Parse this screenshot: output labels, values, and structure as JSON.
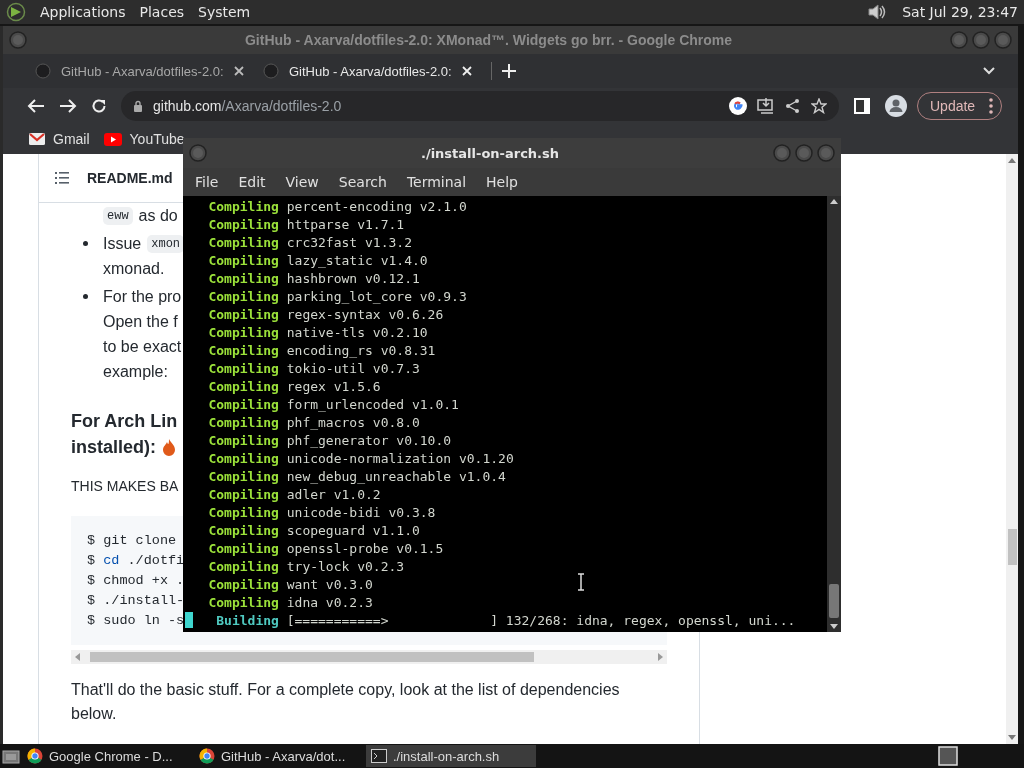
{
  "top_panel": {
    "menus": [
      "Applications",
      "Places",
      "System"
    ],
    "clock": "Sat Jul 29, 23:47"
  },
  "browser": {
    "title": "GitHub - Axarva/dotfiles-2.0: XMonad™. Widgets go brr. - Google Chrome",
    "tabs": [
      {
        "label": "GitHub - Axarva/dotfiles-2.0:",
        "selected": false
      },
      {
        "label": "GitHub - Axarva/dotfiles-2.0:",
        "selected": true
      }
    ],
    "address": {
      "host": "github.com",
      "path": "/Axarva/dotfiles-2.0"
    },
    "update_button": "Update",
    "bookmarks": [
      {
        "kind": "mail",
        "label": "Gmail"
      },
      {
        "kind": "video",
        "label": "YouTube"
      }
    ],
    "readme": {
      "filename": "README.md",
      "blocks": [
        {
          "kind": "line",
          "parts": [
            {
              "kind": "code",
              "text": "eww"
            },
            {
              "kind": "text",
              "text": "as do"
            }
          ]
        },
        {
          "kind": "bullet",
          "parts": [
            {
              "kind": "text",
              "text": "Issue"
            },
            {
              "kind": "code",
              "text": "xmon"
            }
          ]
        },
        {
          "kind": "line",
          "parts": [
            {
              "kind": "text",
              "text": "xmonad."
            }
          ]
        },
        {
          "kind": "bullet",
          "parts": [
            {
              "kind": "text",
              "text": "For the pro"
            }
          ]
        },
        {
          "kind": "line",
          "parts": [
            {
              "kind": "text",
              "text": "Open the f"
            }
          ]
        },
        {
          "kind": "line",
          "parts": [
            {
              "kind": "text",
              "text": "to be exact"
            }
          ]
        },
        {
          "kind": "line",
          "parts": [
            {
              "kind": "text",
              "text": "example:"
            }
          ]
        },
        {
          "kind": "heading",
          "lines": [
            "For Arch Lin",
            "installed):"
          ]
        },
        {
          "kind": "paragraph",
          "text": "THIS MAKES BA"
        },
        {
          "kind": "code",
          "lines": [
            {
              "prompt": "$",
              "command": "git clone"
            },
            {
              "prompt": "$",
              "keyword": "cd",
              "command": "./dotfi"
            },
            {
              "prompt": "$",
              "command": "chmod +x ."
            },
            {
              "prompt": "$",
              "command": "./install-"
            },
            {
              "prompt": "$",
              "command": "sudo ln -s"
            }
          ]
        },
        {
          "kind": "paragraph",
          "text": "That'll do the basic stuff. For a complete copy, look at the list of dependencies below."
        }
      ]
    }
  },
  "terminal": {
    "title": "./install-on-arch.sh",
    "menus": [
      "File",
      "Edit",
      "View",
      "Search",
      "Terminal",
      "Help"
    ],
    "lines": [
      {
        "verb": "Compiling",
        "text": "percent-encoding v2.1.0"
      },
      {
        "verb": "Compiling",
        "text": "httparse v1.7.1"
      },
      {
        "verb": "Compiling",
        "text": "crc32fast v1.3.2"
      },
      {
        "verb": "Compiling",
        "text": "lazy_static v1.4.0"
      },
      {
        "verb": "Compiling",
        "text": "hashbrown v0.12.1"
      },
      {
        "verb": "Compiling",
        "text": "parking_lot_core v0.9.3"
      },
      {
        "verb": "Compiling",
        "text": "regex-syntax v0.6.26"
      },
      {
        "verb": "Compiling",
        "text": "native-tls v0.2.10"
      },
      {
        "verb": "Compiling",
        "text": "encoding_rs v0.8.31"
      },
      {
        "verb": "Compiling",
        "text": "tokio-util v0.7.3"
      },
      {
        "verb": "Compiling",
        "text": "regex v1.5.6"
      },
      {
        "verb": "Compiling",
        "text": "form_urlencoded v1.0.1"
      },
      {
        "verb": "Compiling",
        "text": "phf_macros v0.8.0"
      },
      {
        "verb": "Compiling",
        "text": "phf_generator v0.10.0"
      },
      {
        "verb": "Compiling",
        "text": "unicode-normalization v0.1.20"
      },
      {
        "verb": "Compiling",
        "text": "new_debug_unreachable v1.0.4"
      },
      {
        "verb": "Compiling",
        "text": "adler v1.0.2"
      },
      {
        "verb": "Compiling",
        "text": "unicode-bidi v0.3.8"
      },
      {
        "verb": "Compiling",
        "text": "scopeguard v1.1.0"
      },
      {
        "verb": "Compiling",
        "text": "openssl-probe v0.1.5"
      },
      {
        "verb": "Compiling",
        "text": "try-lock v0.2.3"
      },
      {
        "verb": "Compiling",
        "text": "want v0.3.0"
      },
      {
        "verb": "Compiling",
        "text": "idna v0.2.3"
      }
    ],
    "progress": {
      "verb": "Building",
      "text": "[===========>             ] 132/268: idna, regex, openssl, uni..."
    }
  },
  "taskbar": {
    "items": [
      {
        "kind": "browser",
        "label": "Google Chrome - D...",
        "selected": false
      },
      {
        "kind": "browser",
        "label": "GitHub - Axarva/dot...",
        "selected": false
      },
      {
        "kind": "terminal",
        "label": "./install-on-arch.sh",
        "selected": true
      }
    ]
  }
}
